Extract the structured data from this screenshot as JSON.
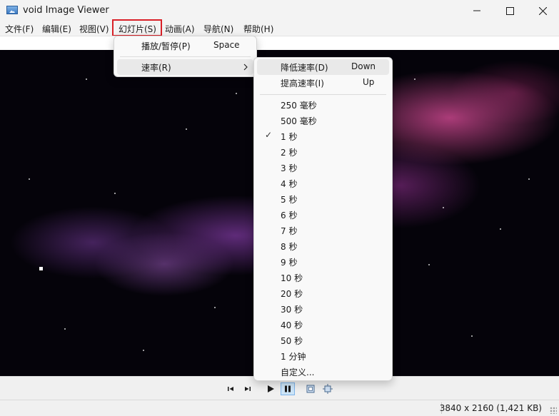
{
  "window": {
    "title": "void Image Viewer",
    "controls": {
      "minimize_icon": "minimize-icon",
      "maximize_icon": "maximize-icon",
      "close_icon": "close-icon"
    }
  },
  "menubar": {
    "items": [
      {
        "label": "文件(F)"
      },
      {
        "label": "编辑(E)"
      },
      {
        "label": "视图(V)"
      },
      {
        "label": "幻灯片(S)",
        "open": true
      },
      {
        "label": "动画(A)"
      },
      {
        "label": "导航(N)"
      },
      {
        "label": "帮助(H)"
      }
    ],
    "highlight_color": "#d92027"
  },
  "slideshow_menu": {
    "items": [
      {
        "label": "播放/暂停(P)",
        "shortcut": "Space"
      },
      {
        "label": "速率(R)",
        "submenu": true,
        "submenu_icon": "chevron-right-icon"
      }
    ]
  },
  "rate_submenu": {
    "top_items": [
      {
        "label": "降低速率(D)",
        "shortcut": "Down"
      },
      {
        "label": "提高速率(I)",
        "shortcut": "Up"
      }
    ],
    "speeds": [
      {
        "label": "250 毫秒"
      },
      {
        "label": "500 毫秒"
      },
      {
        "label": "1 秒",
        "checked": true
      },
      {
        "label": "2 秒"
      },
      {
        "label": "3 秒"
      },
      {
        "label": "4 秒"
      },
      {
        "label": "5 秒"
      },
      {
        "label": "6 秒"
      },
      {
        "label": "7 秒"
      },
      {
        "label": "8 秒"
      },
      {
        "label": "9 秒"
      },
      {
        "label": "10 秒"
      },
      {
        "label": "20 秒"
      },
      {
        "label": "30 秒"
      },
      {
        "label": "40 秒"
      },
      {
        "label": "50 秒"
      },
      {
        "label": "1 分钟"
      },
      {
        "label": "自定义..."
      }
    ],
    "check_mark": "✓"
  },
  "controls": {
    "buttons": [
      {
        "icon": "previous-icon"
      },
      {
        "icon": "next-icon"
      },
      {
        "icon": "play-icon"
      },
      {
        "icon": "pause-icon",
        "pressed": true
      },
      {
        "icon": "fit-window-icon"
      },
      {
        "icon": "actual-size-icon"
      }
    ]
  },
  "status": {
    "image_info": "3840 x 2160 (1,421 KB)"
  }
}
